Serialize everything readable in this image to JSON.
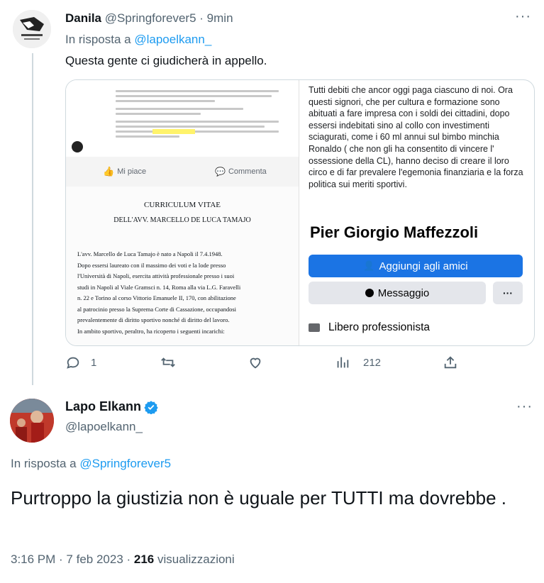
{
  "tweet1": {
    "display_name": "Danila",
    "handle": "@Springforever5",
    "separator": "·",
    "time": "9min",
    "reply_prefix": "In risposta a",
    "reply_handle": "@lapoelkann_",
    "text": "Questa gente ci giudicherà in appello.",
    "more_icon": "more-horizontal-icon",
    "media": {
      "fb_like": "Mi piace",
      "fb_comment": "Commenta",
      "cv_title": "CURRICULUM VITAE",
      "cv_subtitle": "DELL'AVV. MARCELLO DE LUCA TAMAJO",
      "cv_body": [
        "L'avv. Marcello de Luca Tamajo è nato a Napoli il 7.4.1948.",
        "Dopo essersi laureato con il massimo dei voti e la lode presso",
        "l'Università di Napoli, esercita attività professionale presso i suoi",
        "studi in Napoli al Viale Gramsci n. 14, Roma alla via L.G. Faravelli",
        "n. 22 e Torino al corso Vittorio Emanuele II, 170, con abilitazione",
        "al patrocinio presso la Suprema Corte di Cassazione, occupandosi",
        "prevalentemente di diritto sportivo nonché di diritto del lavoro.",
        "In ambito sportivo, peraltro, ha ricoperto i seguenti incarichi:"
      ],
      "post_text": "Tutti debiti che ancor oggi paga ciascuno di noi. Ora questi signori, che per cultura e formazione sono abituati a fare impresa con i soldi dei cittadini, dopo essersi indebitati sino al collo con investimenti sciagurati, come i 60 ml annui sul bimbo minchia Ronaldo ( che non gli ha consentito di vincere l' ossessione della CL), hanno deciso di creare il loro circo e di far prevalere l'egemonia finanziaria e la forza politica sui meriti sportivi.",
      "profile_name": "Pier Giorgio Maffezzoli",
      "add_friend": "Aggiungi agli amici",
      "message": "Messaggio",
      "more": "···",
      "job": "Libero professionista"
    },
    "actions": {
      "replies": "1",
      "retweets": "",
      "likes": "",
      "views": "212"
    }
  },
  "tweet2": {
    "display_name": "Lapo Elkann",
    "handle": "@lapoelkann_",
    "reply_prefix": "In risposta a",
    "reply_handle": "@Springforever5",
    "text": "Purtroppo la giustizia non è uguale per TUTTI ma dovrebbe .",
    "time": "3:16 PM",
    "date": "7 feb 2023",
    "views_count": "216",
    "views_label": "visualizzazioni",
    "more_icon": "more-horizontal-icon",
    "verified_icon": "verified-badge-icon"
  },
  "colors": {
    "accent": "#1d9bf0",
    "muted": "#536471",
    "fb_blue": "#1b74e4",
    "highlight": "#fff36b"
  }
}
